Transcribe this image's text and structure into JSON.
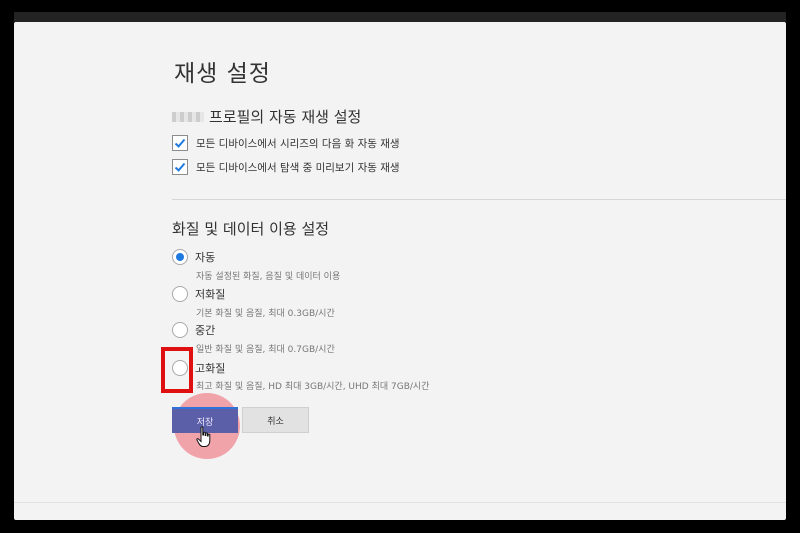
{
  "page": {
    "title": "재생 설정"
  },
  "autoplay": {
    "section_title": "프로필의 자동 재생 설정",
    "options": [
      {
        "label": "모든 디바이스에서 시리즈의 다음 화 자동 재생",
        "checked": true
      },
      {
        "label": "모든 디바이스에서 탐색 중 미리보기 자동 재생",
        "checked": true
      }
    ]
  },
  "quality": {
    "section_title": "화질 및 데이터 이용 설정",
    "options": [
      {
        "label": "자동",
        "desc": "자동 설정된 화질, 음질 및 데이터 이용",
        "selected": true
      },
      {
        "label": "저화질",
        "desc": "기본 화질 및 음질, 최대 0.3GB/시간",
        "selected": false
      },
      {
        "label": "중간",
        "desc": "일반 화질 및 음질, 최대 0.7GB/시간",
        "selected": false
      },
      {
        "label": "고화질",
        "desc": "최고 화질 및 음질, HD 최대 3GB/시간, UHD 최대 7GB/시간",
        "selected": false
      }
    ]
  },
  "actions": {
    "save_label": "저장",
    "cancel_label": "취소"
  },
  "colors": {
    "accent_blue": "#1f7ae0",
    "save_button": "#5a5fa8",
    "highlight_red": "#e01010"
  }
}
